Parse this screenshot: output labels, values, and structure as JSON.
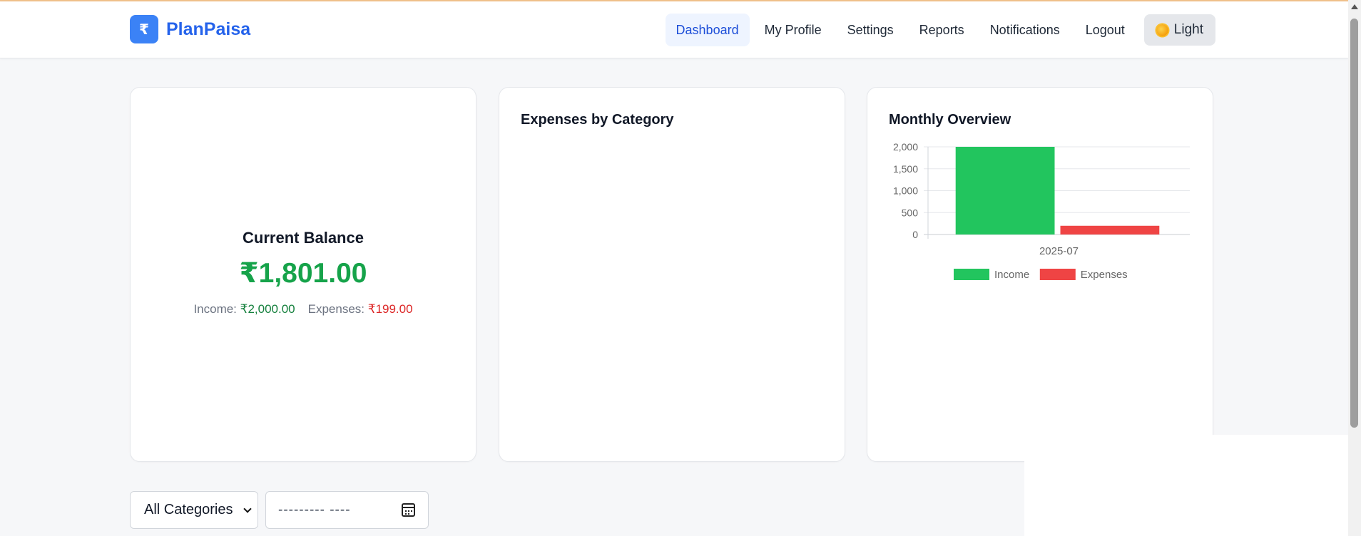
{
  "brand": {
    "logo_glyph": "₹",
    "name": "PlanPaisa",
    "color": "#2563eb"
  },
  "nav": {
    "items": [
      {
        "label": "Dashboard",
        "active": true
      },
      {
        "label": "My Profile",
        "active": false
      },
      {
        "label": "Settings",
        "active": false
      },
      {
        "label": "Reports",
        "active": false
      },
      {
        "label": "Notifications",
        "active": false
      },
      {
        "label": "Logout",
        "active": false
      }
    ],
    "theme_toggle": {
      "label": "Light",
      "icon": "sun-icon"
    }
  },
  "balance": {
    "title": "Current Balance",
    "amount": "₹1,801.00",
    "income_label": "Income: ",
    "income_value": "₹2,000.00",
    "expenses_label": "Expenses: ",
    "expenses_value": "₹199.00"
  },
  "expenses_card": {
    "title": "Expenses by Category"
  },
  "monthly_card": {
    "title": "Monthly Overview"
  },
  "chart_data": {
    "type": "bar",
    "categories": [
      "2025-07"
    ],
    "series": [
      {
        "name": "Income",
        "values": [
          2000
        ],
        "color": "#22c55e"
      },
      {
        "name": "Expenses",
        "values": [
          199
        ],
        "color": "#ef4444"
      }
    ],
    "yticks": [
      "0",
      "500",
      "1,000",
      "1,500",
      "2,000"
    ],
    "ylim": [
      0,
      2000
    ],
    "grid": true,
    "legend": "bottom"
  },
  "filters": {
    "category_select": "All Categories",
    "date_placeholder": "--------- ----"
  },
  "colors": {
    "income": "#16a34a",
    "expenses": "#dc2626",
    "accent": "#3b82f6"
  }
}
